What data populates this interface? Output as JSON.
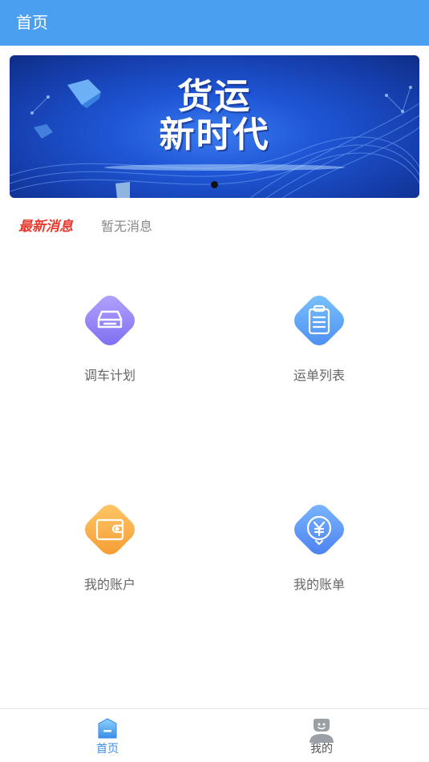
{
  "header": {
    "title": "首页"
  },
  "banner": {
    "headline_line1": "货运",
    "headline_line2": "新时代",
    "active_slide": 1,
    "slide_count": 1
  },
  "news": {
    "tag": "最新消息",
    "text": "暂无消息"
  },
  "menu": {
    "items": [
      {
        "label": "调车计划",
        "icon": "car-icon",
        "color": "#8c7ef0"
      },
      {
        "label": "运单列表",
        "icon": "clipboard-icon",
        "color": "#5aa0f7"
      },
      {
        "label": "我的账户",
        "icon": "wallet-icon",
        "color": "#f7a53a"
      },
      {
        "label": "我的账单",
        "icon": "yen-icon",
        "color": "#5a8ff5"
      }
    ]
  },
  "tabbar": {
    "tabs": [
      {
        "label": "首页",
        "icon": "home-icon",
        "active": true
      },
      {
        "label": "我的",
        "icon": "user-icon",
        "active": false
      }
    ]
  },
  "colors": {
    "primary": "#4b9ff0",
    "accent_red": "#e83a2f",
    "active_tab": "#3a8ee6"
  }
}
